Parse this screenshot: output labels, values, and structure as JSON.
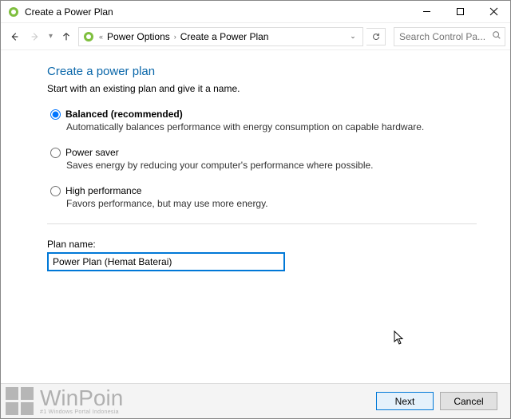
{
  "window": {
    "title": "Create a Power Plan"
  },
  "breadcrumb": {
    "item1": "Power Options",
    "item2": "Create a Power Plan"
  },
  "search": {
    "placeholder": "Search Control Pa..."
  },
  "page": {
    "heading": "Create a power plan",
    "intro": "Start with an existing plan and give it a name.",
    "options": [
      {
        "label": "Balanced (recommended)",
        "desc": "Automatically balances performance with energy consumption on capable hardware."
      },
      {
        "label": "Power saver",
        "desc": "Saves energy by reducing your computer's performance where possible."
      },
      {
        "label": "High performance",
        "desc": "Favors performance, but may use more energy."
      }
    ],
    "planname_label": "Plan name:",
    "planname_value": "Power Plan (Hemat Baterai)"
  },
  "buttons": {
    "next": "Next",
    "cancel": "Cancel"
  },
  "watermark": {
    "brand": "WinPoin",
    "tagline": "#1 Windows Portal Indonesia"
  }
}
